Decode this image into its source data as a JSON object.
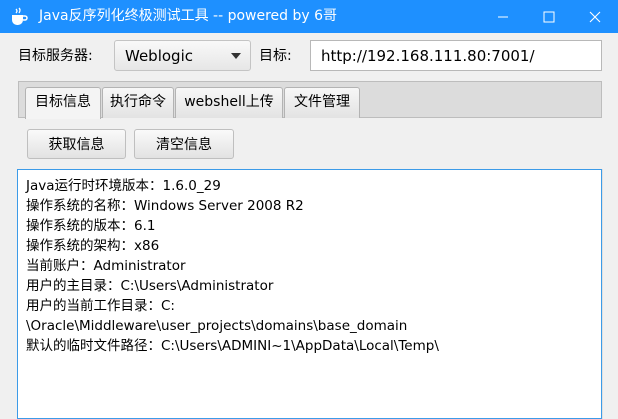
{
  "window": {
    "title": "Java反序列化终极测试工具  -- powered by 6哥",
    "accent_color": "#1e90ff",
    "icons": [
      "coffee-cup-icon",
      "minimize-icon",
      "maximize-icon",
      "close-icon"
    ]
  },
  "form": {
    "server_label": "目标服务器:",
    "server_value": "Weblogic",
    "target_label": "目标:",
    "target_value": "http://192.168.111.80:7001/"
  },
  "tabs": [
    {
      "label": "目标信息",
      "active": true
    },
    {
      "label": "执行命令",
      "active": false
    },
    {
      "label": "webshell上传",
      "active": false
    },
    {
      "label": "文件管理",
      "active": false
    }
  ],
  "buttons": {
    "get_info": "获取信息",
    "clear_info": "清空信息"
  },
  "output": {
    "lines": [
      "Java运行时环境版本：1.6.0_29",
      "操作系统的名称：Windows Server 2008 R2",
      "操作系统的版本：6.1",
      "操作系统的架构：x86",
      "当前账户：Administrator",
      "用户的主目录：C:\\Users\\Administrator",
      "用户的当前工作目录：C:",
      "\\Oracle\\Middleware\\user_projects\\domains\\base_domain",
      "默认的临时文件路径：C:\\Users\\ADMINI~1\\AppData\\Local\\Temp\\"
    ]
  }
}
